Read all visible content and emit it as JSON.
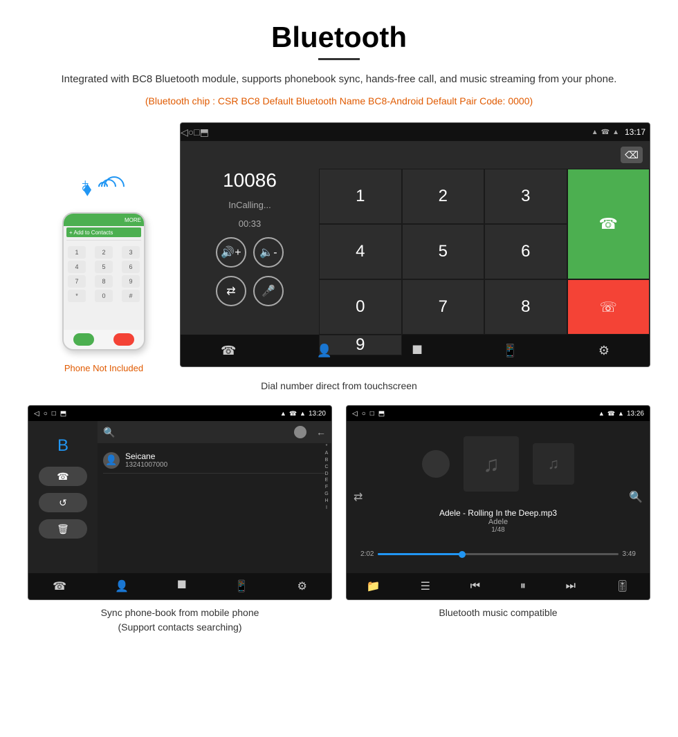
{
  "header": {
    "title": "Bluetooth",
    "description": "Integrated with BC8 Bluetooth module, supports phonebook sync, hands-free call, and music streaming from your phone.",
    "bluetooth_info": "(Bluetooth chip : CSR BC8    Default Bluetooth Name BC8-Android    Default Pair Code: 0000)"
  },
  "dial_screen": {
    "time": "13:17",
    "number": "10086",
    "status": "InCalling...",
    "timer": "00:33",
    "keypad": [
      "1",
      "2",
      "3",
      "*",
      "4",
      "5",
      "6",
      "0",
      "7",
      "8",
      "9",
      "#"
    ],
    "caption": "Dial number direct from touchscreen"
  },
  "phone_label": "Phone Not Included",
  "phonebook_screen": {
    "time": "13:20",
    "contact_name": "Seicane",
    "contact_number": "13241007000",
    "caption": "Sync phone-book from mobile phone\n(Support contacts searching)",
    "alpha": [
      "*",
      "A",
      "B",
      "C",
      "D",
      "E",
      "F",
      "G",
      "H",
      "I"
    ]
  },
  "music_screen": {
    "time": "13:26",
    "song_name": "Adele - Rolling In the Deep.mp3",
    "artist": "Adele",
    "track_count": "1/48",
    "time_current": "2:02",
    "time_total": "3:49",
    "progress_percent": 35,
    "caption": "Bluetooth music compatible"
  },
  "nav_icons": {
    "back": "◁",
    "home": "○",
    "recents": "□",
    "screen": "⬒"
  }
}
